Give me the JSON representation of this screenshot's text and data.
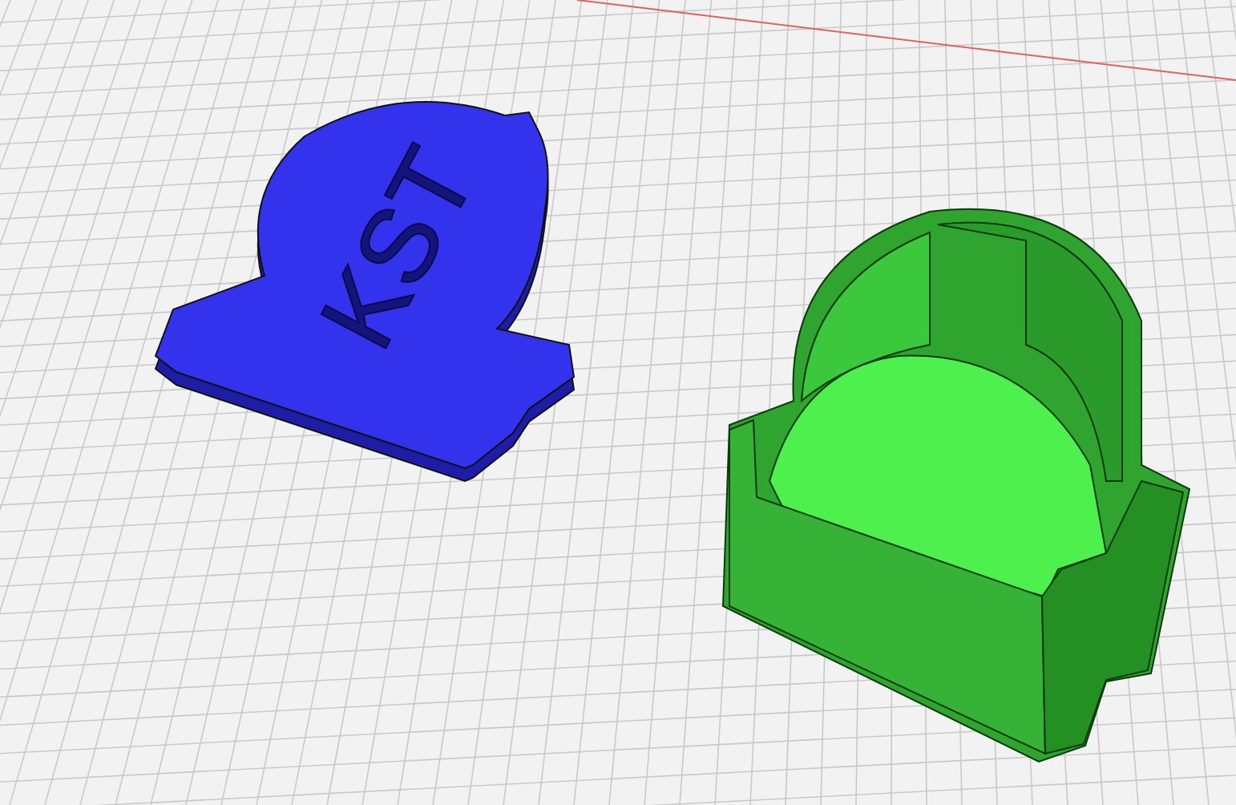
{
  "viewport": {
    "lid": {
      "label": "KST"
    }
  }
}
